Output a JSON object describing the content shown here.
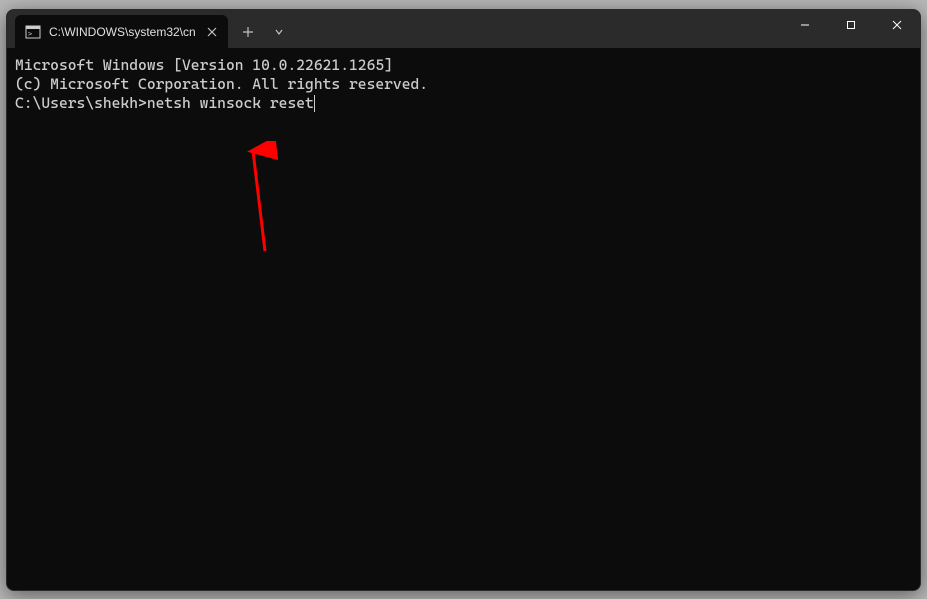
{
  "tab": {
    "title": "C:\\WINDOWS\\system32\\cn"
  },
  "terminal": {
    "line1": "Microsoft Windows [Version 10.0.22621.1265]",
    "line2": "(c) Microsoft Corporation. All rights reserved.",
    "blank": "",
    "prompt": "C:\\Users\\shekh>",
    "command": "netsh winsock reset"
  }
}
